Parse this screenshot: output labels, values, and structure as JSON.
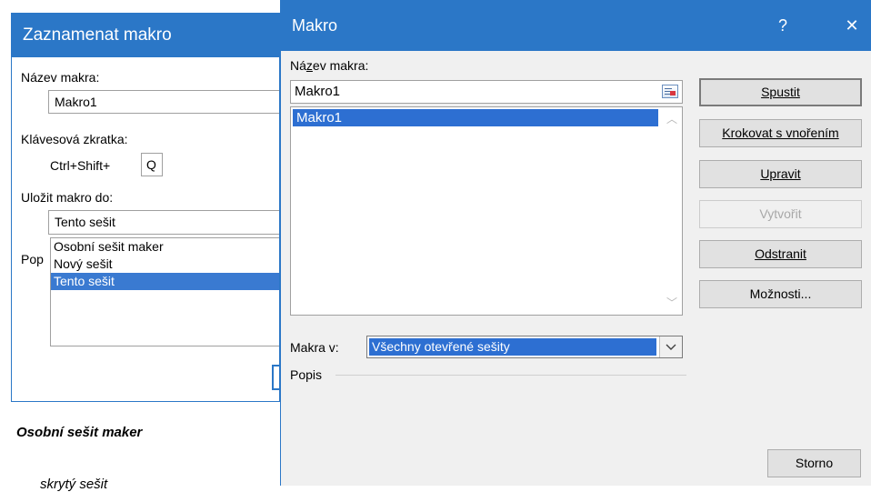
{
  "record_dialog": {
    "title": "Zaznamenat makro",
    "name_label": "Název makra:",
    "name_value": "Makro1",
    "shortcut_label": "Klávesová zkratka:",
    "shortcut_prefix": "Ctrl+Shift+",
    "shortcut_key": "Q",
    "store_label": "Uložit makro do:",
    "store_value": "Tento sešit",
    "store_options": [
      "Osobní sešit maker",
      "Nový sešit",
      "Tento sešit"
    ],
    "description_label_partial": "Pop"
  },
  "caption": {
    "heading": "Osobní sešit maker",
    "sub": "skrytý sešit"
  },
  "macro_dialog": {
    "title": "Makro",
    "help_glyph": "?",
    "close_glyph": "✕",
    "name_label": "Název makra:",
    "name_value": "Makro1",
    "macros": [
      "Makro1"
    ],
    "buttons": {
      "run": "Spustit",
      "step_into": "Krokovat s vnořením",
      "edit": "Upravit",
      "create": "Vytvořit",
      "delete": "Odstranit",
      "options": "Možnosti..."
    },
    "macros_in_label": "Makra v:",
    "macros_in_value": "Všechny otevřené sešity",
    "description_label": "Popis",
    "cancel": "Storno"
  }
}
